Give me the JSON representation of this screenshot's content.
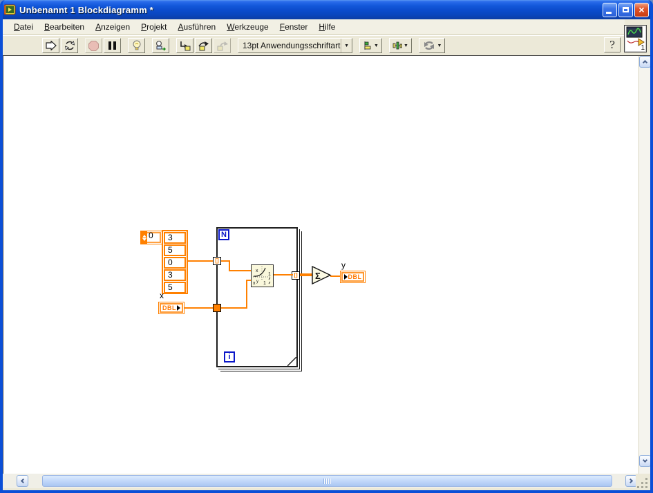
{
  "titlebar": {
    "title": "Unbenannt 1 Blockdiagramm *"
  },
  "icons": {
    "close": "×",
    "dropdown": "▼",
    "help": "?"
  },
  "menus": [
    {
      "key": "D",
      "post": "atei"
    },
    {
      "key": "B",
      "post": "earbeiten"
    },
    {
      "key": "A",
      "post": "nzeigen"
    },
    {
      "key": "P",
      "post": "rojekt"
    },
    {
      "key": "A",
      "post": "usführen"
    },
    {
      "key": "W",
      "post": "erkzeuge"
    },
    {
      "key": "F",
      "post": "enster"
    },
    {
      "key": "H",
      "post": "ilfe"
    }
  ],
  "toolbar": {
    "font_selector": "13pt Anwendungsschriftart"
  },
  "vi_icon": {
    "number": "1"
  },
  "diagram": {
    "array_constant": {
      "index": "0",
      "values": [
        "3",
        "5",
        "0",
        "3",
        "5"
      ]
    },
    "x_control": {
      "label": "x",
      "type": "DBL"
    },
    "y_indicator": {
      "label": "y",
      "type": "DBL"
    },
    "for_loop": {
      "count": "N",
      "iterator": "i"
    },
    "tunnel_glyph": "[]",
    "power_node": {
      "axis_label": "x",
      "base": "x",
      "exponent": "y",
      "one_right": "1",
      "one_bottom": "1"
    },
    "sum_node": {
      "glyph": "Σ"
    }
  },
  "colors": {
    "wire": "#FF8000",
    "terminal_blue": "#0A16C8",
    "titlebar_blue": "#0B4BCB",
    "toolbar_bg": "#ECE9D8"
  }
}
